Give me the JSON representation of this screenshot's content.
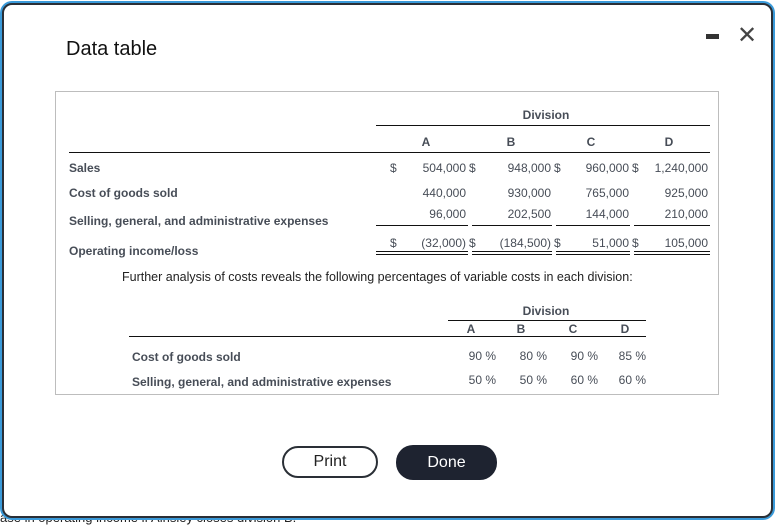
{
  "background_text": "ase in operating income if Ainsley closes division B.",
  "dialog": {
    "title": "Data table",
    "minimize_icon": "minimize-icon",
    "close_icon": "close-icon",
    "close_glyph": "✕"
  },
  "table1": {
    "group_header": "Division",
    "columns": [
      "A",
      "B",
      "C",
      "D"
    ],
    "rows": [
      {
        "label": "Sales",
        "currency": "$",
        "values": [
          "504,000",
          "948,000",
          "960,000",
          "1,240,000"
        ],
        "show_dollar": true
      },
      {
        "label": "Cost of goods sold",
        "values": [
          "440,000",
          "930,000",
          "765,000",
          "925,000"
        ],
        "show_dollar": false
      },
      {
        "label": "Selling, general, and administrative expenses",
        "values": [
          "96,000",
          "202,500",
          "144,000",
          "210,000"
        ],
        "show_dollar": false
      },
      {
        "label": "Operating income/loss",
        "currency": "$",
        "values": [
          "(32,000)",
          "(184,500)",
          "51,000",
          "105,000"
        ],
        "show_dollar": true
      }
    ]
  },
  "analysis_text": "Further analysis of costs reveals the following percentages of variable costs in each division:",
  "table2": {
    "group_header": "Division",
    "columns": [
      "A",
      "B",
      "C",
      "D"
    ],
    "rows": [
      {
        "label": "Cost of goods sold",
        "values": [
          "90 %",
          "80 %",
          "90 %",
          "85 %"
        ]
      },
      {
        "label": "Selling, general, and administrative expenses",
        "values": [
          "50 %",
          "50 %",
          "60 %",
          "60 %"
        ]
      }
    ]
  },
  "buttons": {
    "print": "Print",
    "done": "Done"
  }
}
